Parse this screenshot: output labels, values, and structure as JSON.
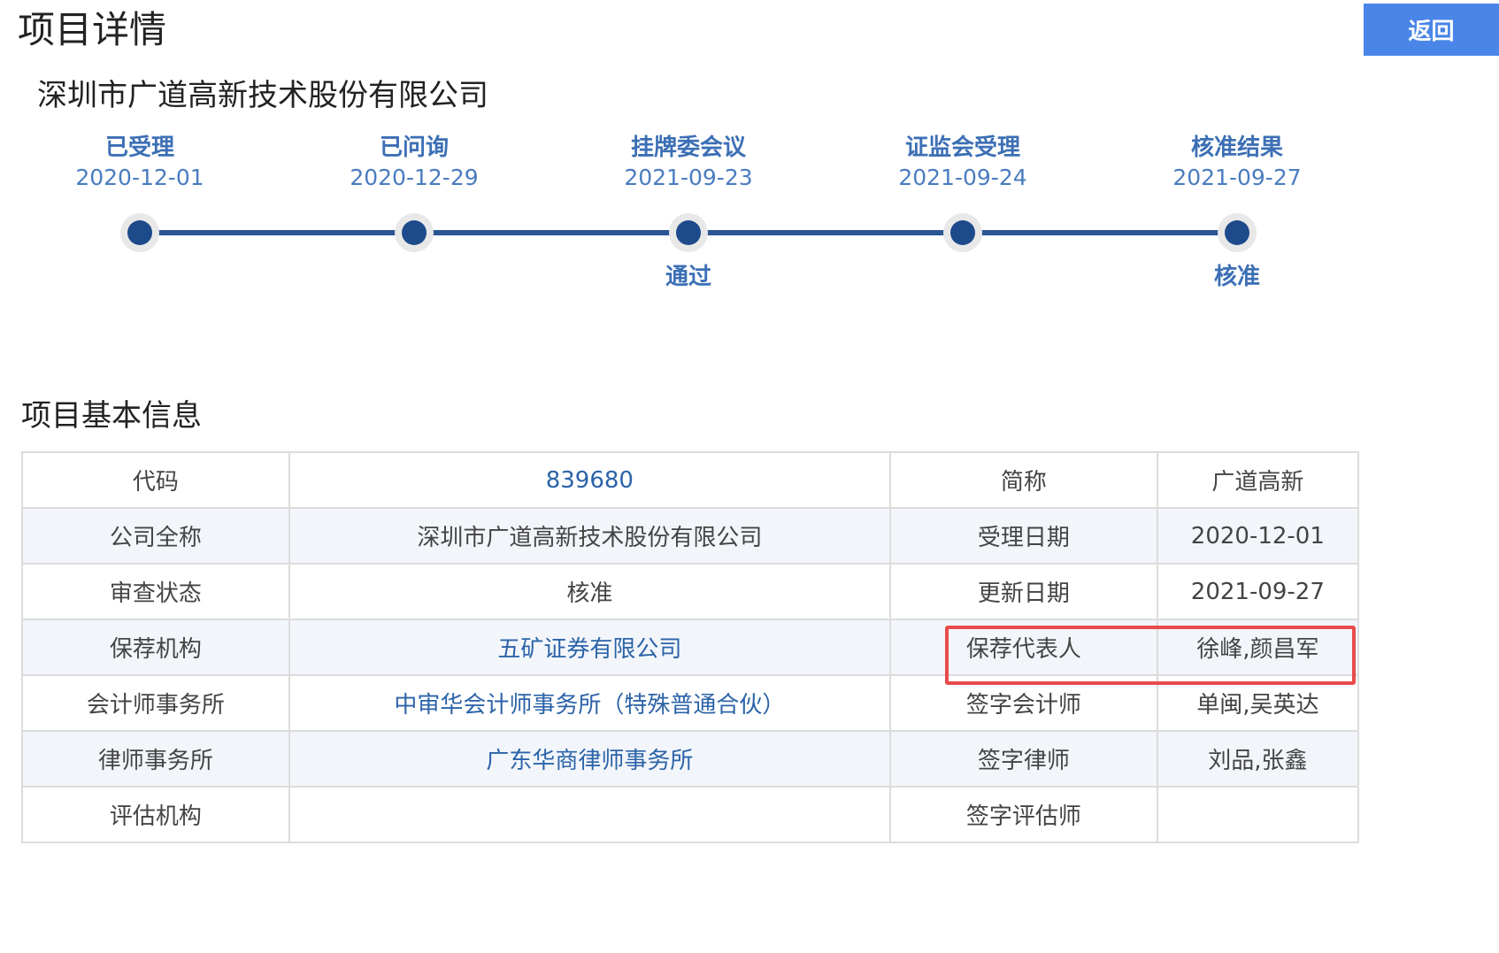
{
  "header": {
    "title": "项目详情",
    "back_label": "返回"
  },
  "company": {
    "name": "深圳市广道高新技术股份有限公司"
  },
  "timeline": {
    "steps": [
      {
        "label": "已受理",
        "date": "2020-12-01",
        "result": ""
      },
      {
        "label": "已问询",
        "date": "2020-12-29",
        "result": ""
      },
      {
        "label": "挂牌委会议",
        "date": "2021-09-23",
        "result": "通过"
      },
      {
        "label": "证监会受理",
        "date": "2021-09-24",
        "result": ""
      },
      {
        "label": "核准结果",
        "date": "2021-09-27",
        "result": "核准"
      }
    ]
  },
  "basic_info": {
    "title": "项目基本信息",
    "rows": [
      {
        "k1": "代码",
        "v1": "839680",
        "k2": "简称",
        "v2": "广道高新"
      },
      {
        "k1": "公司全称",
        "v1": "深圳市广道高新技术股份有限公司",
        "k2": "受理日期",
        "v2": "2020-12-01"
      },
      {
        "k1": "审查状态",
        "v1": "核准",
        "k2": "更新日期",
        "v2": "2021-09-27"
      },
      {
        "k1": "保荐机构",
        "v1": "五矿证券有限公司",
        "k2": "保荐代表人",
        "v2": "徐峰,颜昌军"
      },
      {
        "k1": "会计师事务所",
        "v1": "中审华会计师事务所（特殊普通合伙）",
        "k2": "签字会计师",
        "v2": "单闽,吴英达"
      },
      {
        "k1": "律师事务所",
        "v1": "广东华商律师事务所",
        "k2": "签字律师",
        "v2": "刘品,张鑫"
      },
      {
        "k1": "评估机构",
        "v1": "",
        "k2": "签字评估师",
        "v2": ""
      }
    ]
  },
  "colors": {
    "accent": "#4a86e8",
    "timeline": "#1d4a8a",
    "link": "#2c63a8",
    "highlight": "#e84b4b"
  }
}
